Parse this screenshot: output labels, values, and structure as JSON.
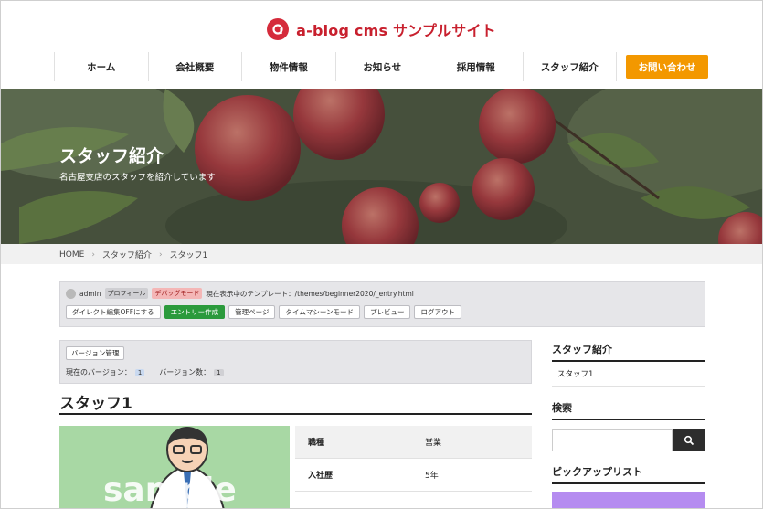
{
  "header": {
    "site_title": "a-blog cms サンプルサイト",
    "nav": [
      "ホーム",
      "会社概要",
      "物件情報",
      "お知らせ",
      "採用情報",
      "スタッフ紹介"
    ],
    "cta": "お問い合わせ",
    "brand_color": "#d52b3b",
    "cta_color": "#f39800"
  },
  "hero": {
    "title": "スタッフ紹介",
    "subtitle": "名古屋支店のスタッフを紹介しています"
  },
  "breadcrumb": [
    "HOME",
    "スタッフ紹介",
    "スタッフ1"
  ],
  "admin": {
    "user": "admin",
    "profile": "プロフィール",
    "debug": "デバッグモード",
    "template_info": "現在表示中のテンプレート：/themes/beginner2020/_entry.html",
    "buttons": [
      "ダイレクト編集OFFにする",
      "エントリー作成",
      "管理ページ",
      "タイムマシーンモード",
      "プレビュー",
      "ログアウト"
    ]
  },
  "version": {
    "button": "バージョン管理",
    "current_label": "現在のバージョン：",
    "current_value": "1",
    "count_label": "バージョン数：",
    "count_value": "1"
  },
  "entry": {
    "title": "スタッフ1",
    "specs": [
      {
        "key": "職種",
        "value": "営業"
      },
      {
        "key": "入社歴",
        "value": "5年"
      }
    ],
    "image_text": "sample"
  },
  "sidebar": {
    "staff_heading": "スタッフ紹介",
    "staff_link": "スタッフ1",
    "search_heading": "検索",
    "pickup_heading": "ピックアップリスト"
  }
}
